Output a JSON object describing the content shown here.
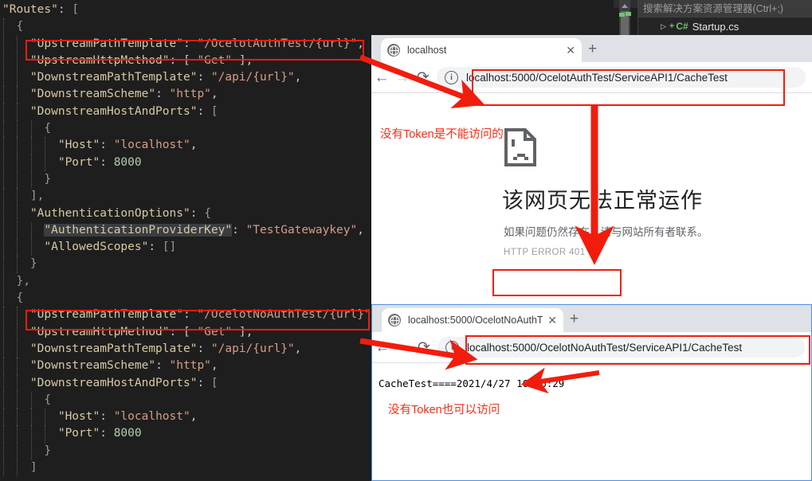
{
  "editor": {
    "language": "json",
    "filename_context": "ocelot configuration",
    "lines": [
      {
        "indent": 0,
        "tokens": [
          {
            "t": "\"Routes\"",
            "c": "k"
          },
          {
            "t": ": ",
            "c": "p"
          },
          {
            "t": "[",
            "c": "b"
          }
        ]
      },
      {
        "indent": 1,
        "tokens": [
          {
            "t": "{",
            "c": "b"
          }
        ]
      },
      {
        "indent": 2,
        "tokens": [
          {
            "t": "\"UpstreamPathTemplate\"",
            "c": "k"
          },
          {
            "t": ": ",
            "c": "p"
          },
          {
            "t": "\"/OcelotAuthTest/{url}\"",
            "c": "s"
          },
          {
            "t": ",",
            "c": "p"
          }
        ]
      },
      {
        "indent": 2,
        "tokens": [
          {
            "t": "\"UpstreamHttpMethod\"",
            "c": "k"
          },
          {
            "t": ": [ ",
            "c": "p"
          },
          {
            "t": "\"Get\"",
            "c": "s"
          },
          {
            "t": " ],",
            "c": "p"
          }
        ]
      },
      {
        "indent": 2,
        "tokens": [
          {
            "t": "\"DownstreamPathTemplate\"",
            "c": "k"
          },
          {
            "t": ": ",
            "c": "p"
          },
          {
            "t": "\"/api/{url}\"",
            "c": "s"
          },
          {
            "t": ",",
            "c": "p"
          }
        ]
      },
      {
        "indent": 2,
        "tokens": [
          {
            "t": "\"DownstreamScheme\"",
            "c": "k"
          },
          {
            "t": ": ",
            "c": "p"
          },
          {
            "t": "\"http\"",
            "c": "s"
          },
          {
            "t": ",",
            "c": "p"
          }
        ]
      },
      {
        "indent": 2,
        "tokens": [
          {
            "t": "\"DownstreamHostAndPorts\"",
            "c": "k"
          },
          {
            "t": ": ",
            "c": "p"
          },
          {
            "t": "[",
            "c": "b"
          }
        ]
      },
      {
        "indent": 3,
        "tokens": [
          {
            "t": "{",
            "c": "b"
          }
        ]
      },
      {
        "indent": 4,
        "tokens": [
          {
            "t": "\"Host\"",
            "c": "k"
          },
          {
            "t": ": ",
            "c": "p"
          },
          {
            "t": "\"localhost\"",
            "c": "s"
          },
          {
            "t": ",",
            "c": "p"
          }
        ]
      },
      {
        "indent": 4,
        "tokens": [
          {
            "t": "\"Port\"",
            "c": "k"
          },
          {
            "t": ": ",
            "c": "p"
          },
          {
            "t": "8000",
            "c": "n"
          }
        ]
      },
      {
        "indent": 3,
        "tokens": [
          {
            "t": "}",
            "c": "b"
          }
        ]
      },
      {
        "indent": 2,
        "tokens": [
          {
            "t": "],",
            "c": "b"
          }
        ]
      },
      {
        "indent": 2,
        "tokens": [
          {
            "t": "\"AuthenticationOptions\"",
            "c": "k"
          },
          {
            "t": ": ",
            "c": "p"
          },
          {
            "t": "{",
            "c": "b"
          }
        ]
      },
      {
        "indent": 3,
        "tokens": [
          {
            "t": "\"AuthenticationProviderKey\"",
            "c": "k sel"
          },
          {
            "t": ": ",
            "c": "p"
          },
          {
            "t": "\"TestGatewaykey\"",
            "c": "s"
          },
          {
            "t": ",",
            "c": "p"
          }
        ]
      },
      {
        "indent": 3,
        "tokens": [
          {
            "t": "\"AllowedScopes\"",
            "c": "k"
          },
          {
            "t": ": ",
            "c": "p"
          },
          {
            "t": "[]",
            "c": "b"
          }
        ]
      },
      {
        "indent": 2,
        "tokens": [
          {
            "t": "}",
            "c": "b"
          }
        ]
      },
      {
        "indent": 1,
        "tokens": [
          {
            "t": "},",
            "c": "b"
          }
        ]
      },
      {
        "indent": 1,
        "tokens": [
          {
            "t": "{",
            "c": "b"
          }
        ]
      },
      {
        "indent": 2,
        "tokens": [
          {
            "t": "\"UpstreamPathTemplate\"",
            "c": "k"
          },
          {
            "t": ": ",
            "c": "p"
          },
          {
            "t": "\"/OcelotNoAuthTest/{url}\"",
            "c": "s"
          },
          {
            "t": ",",
            "c": "p"
          }
        ]
      },
      {
        "indent": 2,
        "tokens": [
          {
            "t": "\"UpstreamHttpMethod\"",
            "c": "k"
          },
          {
            "t": ": [ ",
            "c": "p"
          },
          {
            "t": "\"Get\"",
            "c": "s"
          },
          {
            "t": " ],",
            "c": "p"
          }
        ]
      },
      {
        "indent": 2,
        "tokens": [
          {
            "t": "\"DownstreamPathTemplate\"",
            "c": "k"
          },
          {
            "t": ": ",
            "c": "p"
          },
          {
            "t": "\"/api/{url}\"",
            "c": "s"
          },
          {
            "t": ",",
            "c": "p"
          }
        ]
      },
      {
        "indent": 2,
        "tokens": [
          {
            "t": "\"DownstreamScheme\"",
            "c": "k"
          },
          {
            "t": ": ",
            "c": "p"
          },
          {
            "t": "\"http\"",
            "c": "s"
          },
          {
            "t": ",",
            "c": "p"
          }
        ]
      },
      {
        "indent": 2,
        "tokens": [
          {
            "t": "\"DownstreamHostAndPorts\"",
            "c": "k"
          },
          {
            "t": ": ",
            "c": "p"
          },
          {
            "t": "[",
            "c": "b"
          }
        ]
      },
      {
        "indent": 3,
        "tokens": [
          {
            "t": "{",
            "c": "b"
          }
        ]
      },
      {
        "indent": 4,
        "tokens": [
          {
            "t": "\"Host\"",
            "c": "k"
          },
          {
            "t": ": ",
            "c": "p"
          },
          {
            "t": "\"localhost\"",
            "c": "s"
          },
          {
            "t": ",",
            "c": "p"
          }
        ]
      },
      {
        "indent": 4,
        "tokens": [
          {
            "t": "\"Port\"",
            "c": "k"
          },
          {
            "t": ": ",
            "c": "p"
          },
          {
            "t": "8000",
            "c": "n"
          }
        ]
      },
      {
        "indent": 3,
        "tokens": [
          {
            "t": "}",
            "c": "b"
          }
        ]
      },
      {
        "indent": 2,
        "tokens": [
          {
            "t": "]",
            "c": "b"
          }
        ]
      }
    ]
  },
  "solution_explorer": {
    "search_placeholder": "搜索解决方案资源管理器(Ctrl+;)",
    "expand_glyph": "▷",
    "file_icon_label": "C#",
    "file_name": "Startup.cs"
  },
  "browser1": {
    "tab": {
      "title": "localhost",
      "close_label": "✕"
    },
    "new_tab_label": "+",
    "nav": {
      "back": "←",
      "forward": "→",
      "reload": "⟳"
    },
    "omnibox": {
      "info_glyph": "i",
      "url": "localhost:5000/OcelotAuthTest/ServiceAPI1/CacheTest"
    },
    "error_page": {
      "heading": "该网页无法正常运作",
      "subtext": "如果问题仍然存在，请与网站所有者联系。",
      "code": "HTTP ERROR 401"
    }
  },
  "browser2": {
    "tab": {
      "title": "localhost:5000/OcelotNoAuthT",
      "close_label": "✕"
    },
    "new_tab_label": "+",
    "nav": {
      "back": "←",
      "forward": "→",
      "reload": "⟳"
    },
    "omnibox": {
      "info_glyph": "i",
      "url": "localhost:5000/OcelotNoAuthTest/ServiceAPI1/CacheTest"
    },
    "content": "CacheTest====2021/4/27 16:16:29"
  },
  "annotations": {
    "note_top": "没有Token是不能访问的",
    "note_bottom": "没有Token也可以访问",
    "accent_red": "#f21c0d",
    "note_color": "#ff2a12"
  }
}
